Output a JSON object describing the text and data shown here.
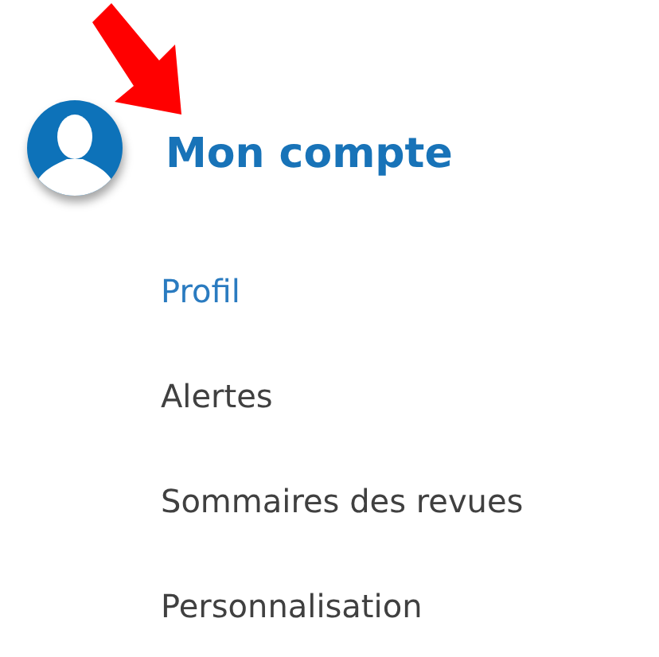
{
  "header": {
    "title": "Mon compte"
  },
  "menu": [
    {
      "label": "Profil",
      "selected": true
    },
    {
      "label": "Alertes",
      "selected": false
    },
    {
      "label": "Sommaires des revues",
      "selected": false
    },
    {
      "label": "Personnalisation",
      "selected": false
    }
  ]
}
